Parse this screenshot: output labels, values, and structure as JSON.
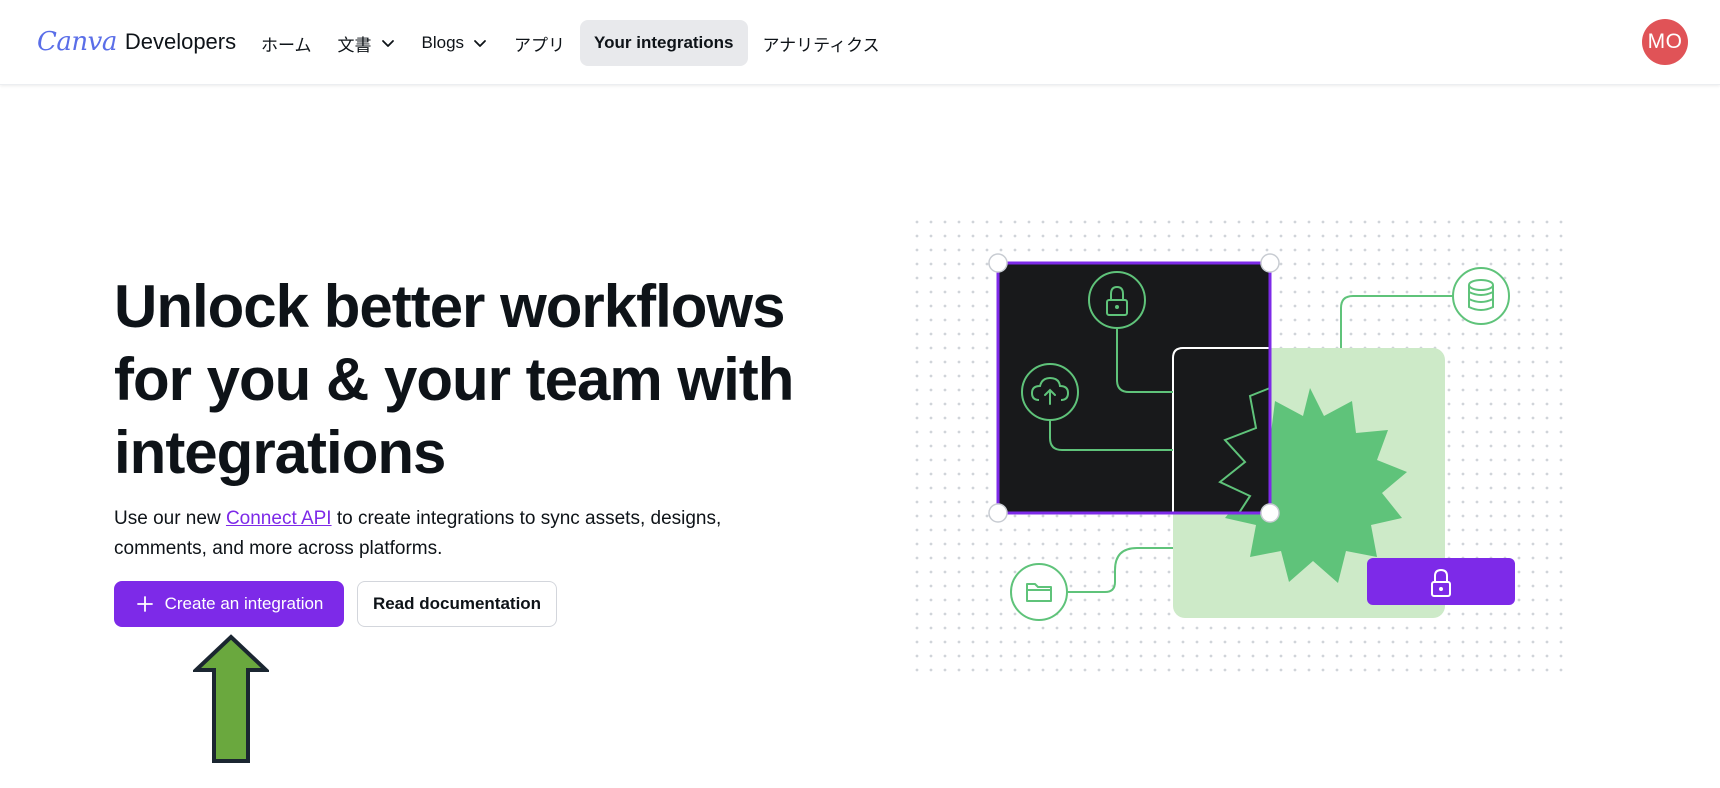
{
  "header": {
    "brand_logo": "Canva",
    "brand_word": "Developers",
    "nav": [
      {
        "label": "ホーム",
        "dropdown": false,
        "active": false
      },
      {
        "label": "文書",
        "dropdown": true,
        "active": false
      },
      {
        "label": "Blogs",
        "dropdown": true,
        "active": false
      },
      {
        "label": "アプリ",
        "dropdown": false,
        "active": false
      },
      {
        "label": "Your integrations",
        "dropdown": false,
        "active": true
      },
      {
        "label": "アナリティクス",
        "dropdown": false,
        "active": false
      }
    ],
    "avatar_initials": "MO"
  },
  "hero": {
    "title_lines": [
      "Unlock better workflows",
      "for you & your team with",
      "integrations"
    ],
    "desc_before": "Use our new ",
    "desc_link": "Connect API",
    "desc_after": " to create integrations to sync assets, designs, comments, and more across platforms.",
    "primary_button": "Create an integration",
    "secondary_button": "Read documentation"
  },
  "icons": {
    "plus": "plus-icon",
    "chevron": "chevron-down-icon",
    "lock": "lock-icon",
    "cloud_upload": "cloud-upload-icon",
    "database": "database-icon",
    "folder": "folder-icon",
    "arrow": "up-arrow-annotation"
  },
  "colors": {
    "brand_purple": "#7d2ae8",
    "avatar_red": "#e05357",
    "green": "#5fc37a",
    "light_green": "#cdeac8",
    "dark_panel": "#18191b",
    "arrow_green": "#6aa83e"
  }
}
